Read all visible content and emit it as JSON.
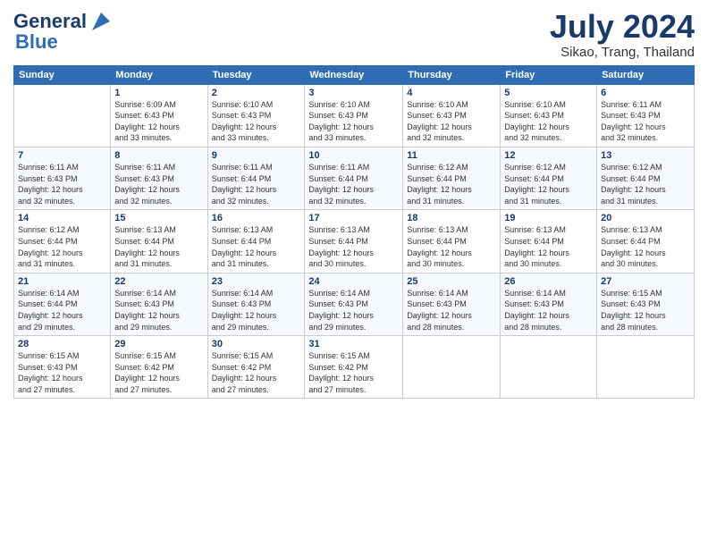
{
  "logo": {
    "line1": "General",
    "line2": "Blue"
  },
  "header": {
    "month": "July 2024",
    "location": "Sikao, Trang, Thailand"
  },
  "days_of_week": [
    "Sunday",
    "Monday",
    "Tuesday",
    "Wednesday",
    "Thursday",
    "Friday",
    "Saturday"
  ],
  "weeks": [
    [
      {
        "day": "",
        "info": ""
      },
      {
        "day": "1",
        "info": "Sunrise: 6:09 AM\nSunset: 6:43 PM\nDaylight: 12 hours\nand 33 minutes."
      },
      {
        "day": "2",
        "info": "Sunrise: 6:10 AM\nSunset: 6:43 PM\nDaylight: 12 hours\nand 33 minutes."
      },
      {
        "day": "3",
        "info": "Sunrise: 6:10 AM\nSunset: 6:43 PM\nDaylight: 12 hours\nand 33 minutes."
      },
      {
        "day": "4",
        "info": "Sunrise: 6:10 AM\nSunset: 6:43 PM\nDaylight: 12 hours\nand 32 minutes."
      },
      {
        "day": "5",
        "info": "Sunrise: 6:10 AM\nSunset: 6:43 PM\nDaylight: 12 hours\nand 32 minutes."
      },
      {
        "day": "6",
        "info": "Sunrise: 6:11 AM\nSunset: 6:43 PM\nDaylight: 12 hours\nand 32 minutes."
      }
    ],
    [
      {
        "day": "7",
        "info": "Sunrise: 6:11 AM\nSunset: 6:43 PM\nDaylight: 12 hours\nand 32 minutes."
      },
      {
        "day": "8",
        "info": "Sunrise: 6:11 AM\nSunset: 6:43 PM\nDaylight: 12 hours\nand 32 minutes."
      },
      {
        "day": "9",
        "info": "Sunrise: 6:11 AM\nSunset: 6:44 PM\nDaylight: 12 hours\nand 32 minutes."
      },
      {
        "day": "10",
        "info": "Sunrise: 6:11 AM\nSunset: 6:44 PM\nDaylight: 12 hours\nand 32 minutes."
      },
      {
        "day": "11",
        "info": "Sunrise: 6:12 AM\nSunset: 6:44 PM\nDaylight: 12 hours\nand 31 minutes."
      },
      {
        "day": "12",
        "info": "Sunrise: 6:12 AM\nSunset: 6:44 PM\nDaylight: 12 hours\nand 31 minutes."
      },
      {
        "day": "13",
        "info": "Sunrise: 6:12 AM\nSunset: 6:44 PM\nDaylight: 12 hours\nand 31 minutes."
      }
    ],
    [
      {
        "day": "14",
        "info": "Sunrise: 6:12 AM\nSunset: 6:44 PM\nDaylight: 12 hours\nand 31 minutes."
      },
      {
        "day": "15",
        "info": "Sunrise: 6:13 AM\nSunset: 6:44 PM\nDaylight: 12 hours\nand 31 minutes."
      },
      {
        "day": "16",
        "info": "Sunrise: 6:13 AM\nSunset: 6:44 PM\nDaylight: 12 hours\nand 31 minutes."
      },
      {
        "day": "17",
        "info": "Sunrise: 6:13 AM\nSunset: 6:44 PM\nDaylight: 12 hours\nand 30 minutes."
      },
      {
        "day": "18",
        "info": "Sunrise: 6:13 AM\nSunset: 6:44 PM\nDaylight: 12 hours\nand 30 minutes."
      },
      {
        "day": "19",
        "info": "Sunrise: 6:13 AM\nSunset: 6:44 PM\nDaylight: 12 hours\nand 30 minutes."
      },
      {
        "day": "20",
        "info": "Sunrise: 6:13 AM\nSunset: 6:44 PM\nDaylight: 12 hours\nand 30 minutes."
      }
    ],
    [
      {
        "day": "21",
        "info": "Sunrise: 6:14 AM\nSunset: 6:44 PM\nDaylight: 12 hours\nand 29 minutes."
      },
      {
        "day": "22",
        "info": "Sunrise: 6:14 AM\nSunset: 6:43 PM\nDaylight: 12 hours\nand 29 minutes."
      },
      {
        "day": "23",
        "info": "Sunrise: 6:14 AM\nSunset: 6:43 PM\nDaylight: 12 hours\nand 29 minutes."
      },
      {
        "day": "24",
        "info": "Sunrise: 6:14 AM\nSunset: 6:43 PM\nDaylight: 12 hours\nand 29 minutes."
      },
      {
        "day": "25",
        "info": "Sunrise: 6:14 AM\nSunset: 6:43 PM\nDaylight: 12 hours\nand 28 minutes."
      },
      {
        "day": "26",
        "info": "Sunrise: 6:14 AM\nSunset: 6:43 PM\nDaylight: 12 hours\nand 28 minutes."
      },
      {
        "day": "27",
        "info": "Sunrise: 6:15 AM\nSunset: 6:43 PM\nDaylight: 12 hours\nand 28 minutes."
      }
    ],
    [
      {
        "day": "28",
        "info": "Sunrise: 6:15 AM\nSunset: 6:43 PM\nDaylight: 12 hours\nand 27 minutes."
      },
      {
        "day": "29",
        "info": "Sunrise: 6:15 AM\nSunset: 6:42 PM\nDaylight: 12 hours\nand 27 minutes."
      },
      {
        "day": "30",
        "info": "Sunrise: 6:15 AM\nSunset: 6:42 PM\nDaylight: 12 hours\nand 27 minutes."
      },
      {
        "day": "31",
        "info": "Sunrise: 6:15 AM\nSunset: 6:42 PM\nDaylight: 12 hours\nand 27 minutes."
      },
      {
        "day": "",
        "info": ""
      },
      {
        "day": "",
        "info": ""
      },
      {
        "day": "",
        "info": ""
      }
    ]
  ]
}
